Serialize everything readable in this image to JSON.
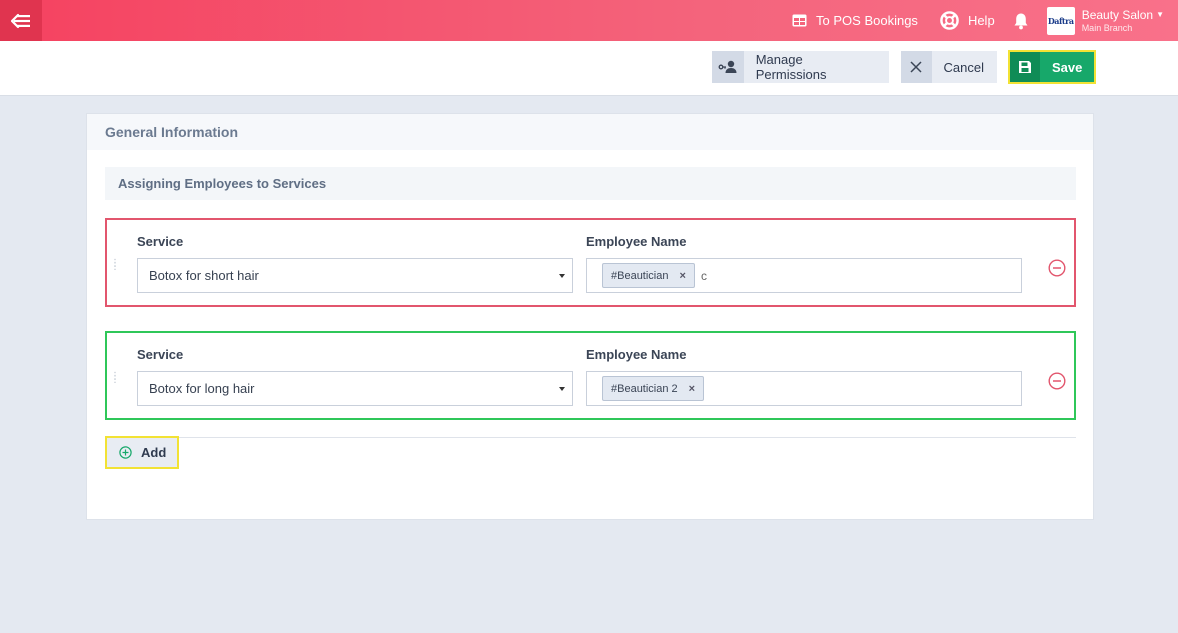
{
  "topbar": {
    "pos_bookings_label": "To POS Bookings",
    "help_label": "Help",
    "account_name": "Beauty Salon",
    "account_branch": "Main Branch",
    "logo_text": "Daftra",
    "accent_color": "#f54260"
  },
  "toolbar": {
    "permissions_label": "Manage Permissions",
    "cancel_label": "Cancel",
    "save_label": "Save"
  },
  "card": {
    "header": "General Information",
    "section_title": "Assigning Employees to Services"
  },
  "rows": [
    {
      "service_label": "Service",
      "service_value": "Botox for short hair",
      "employee_label": "Employee Name",
      "employees": [
        "#Beautician"
      ],
      "typed_text": "c",
      "border_color": "#e2566d"
    },
    {
      "service_label": "Service",
      "service_value": "Botox for long hair",
      "employee_label": "Employee Name",
      "employees": [
        "#Beautician 2"
      ],
      "typed_text": "",
      "border_color": "#2fc759"
    }
  ],
  "add_label": "Add",
  "tag_remove_glyph": "×"
}
